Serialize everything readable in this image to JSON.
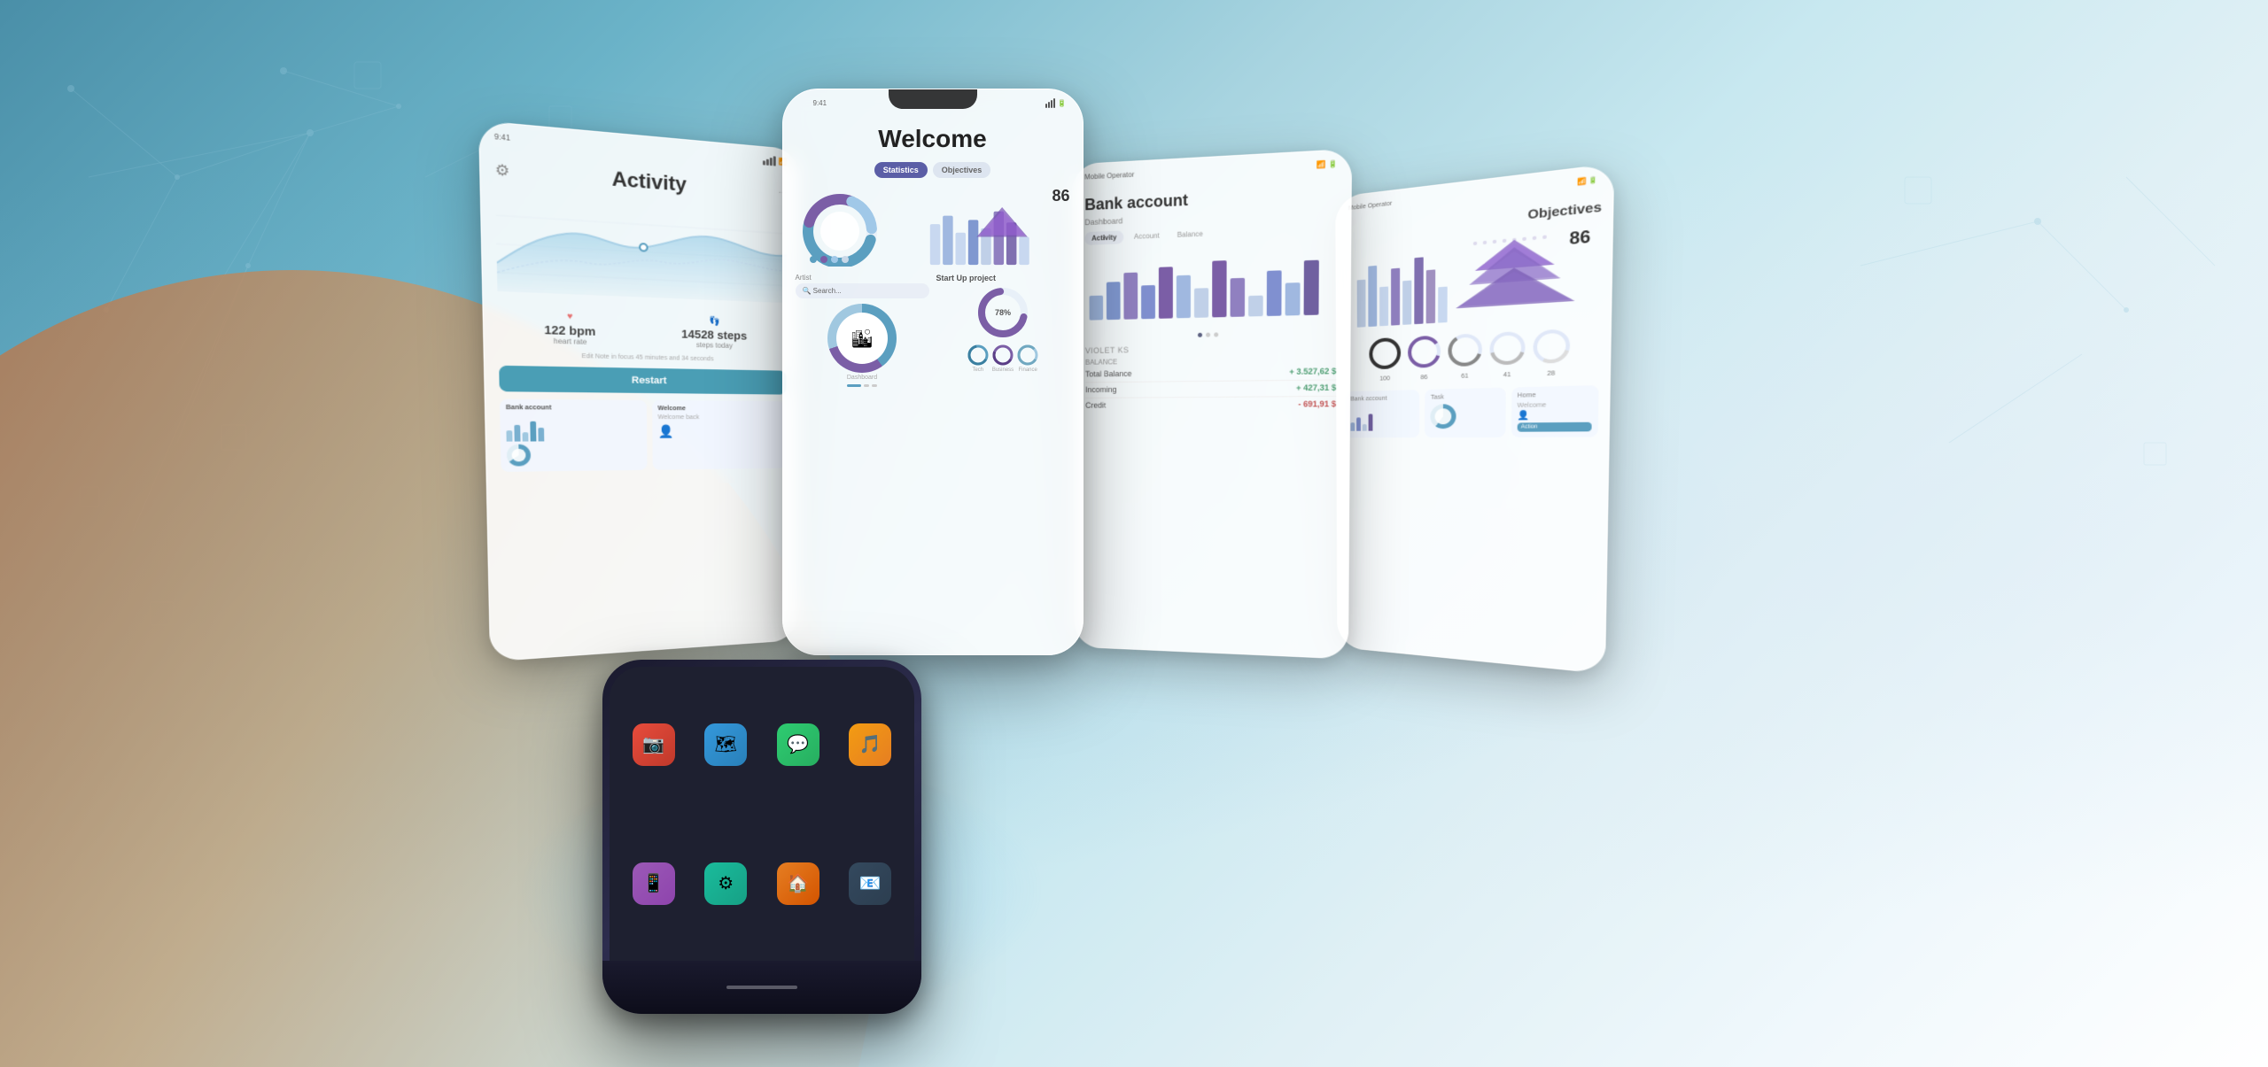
{
  "background": {
    "gradient_start": "#4a8fa8",
    "gradient_end": "#ffffff"
  },
  "phones": {
    "phone1": {
      "title": "Activity",
      "gear_icon": "⚙",
      "stats": [
        {
          "value": "122 bpm",
          "label": "heart rate"
        },
        {
          "value": "14528 steps",
          "label": "today"
        }
      ],
      "restart_button": "Restart",
      "bottom_cards": [
        {
          "title": "Bank account"
        },
        {
          "title": "Welcome"
        }
      ]
    },
    "phone2": {
      "title": "Welcome",
      "tabs": [
        {
          "label": "Statistics",
          "active": false
        },
        {
          "label": "Objectives",
          "active": true
        }
      ],
      "number": "86",
      "percent": "78%",
      "artist_label": "Artist",
      "startup_label": "Start Up project"
    },
    "phone3": {
      "title": "Bank account",
      "subtitle": "Dashboard",
      "tabs": [
        "Activity",
        "Account",
        "Balance"
      ],
      "active_tab": "Activity",
      "dots": 3,
      "balance_label": "BALANCE",
      "balance_rows": [
        {
          "name": "Total Balance",
          "value": "+ 3.527,62 $",
          "color": "green"
        },
        {
          "name": "Incoming",
          "value": "+ 427,31 $",
          "color": "green"
        },
        {
          "name": "Credit",
          "value": "- 691,91 $",
          "color": "red"
        }
      ]
    },
    "phone4": {
      "title": "Objectives",
      "number": "86",
      "circles": [
        {
          "value": "100",
          "color": "#333"
        },
        {
          "value": "86",
          "color": "#5b5ea6"
        },
        {
          "value": "61",
          "color": "#888"
        },
        {
          "value": "41",
          "color": "#bbb"
        },
        {
          "value": "28",
          "color": "#ddd"
        }
      ],
      "bottom_sections": [
        {
          "title": "Bank account"
        },
        {
          "title": "Task"
        },
        {
          "title": "Home"
        }
      ],
      "welcome_label": "Welcome"
    }
  },
  "main_phone": {
    "app_icons": [
      {
        "color": "#e74c3c",
        "emoji": "📷"
      },
      {
        "color": "#3498db",
        "emoji": "🗺"
      },
      {
        "color": "#2ecc71",
        "emoji": "💬"
      },
      {
        "color": "#f39c12",
        "emoji": "🎵"
      },
      {
        "color": "#9b59b6",
        "emoji": "📱"
      },
      {
        "color": "#1abc9c",
        "emoji": "⚙"
      },
      {
        "color": "#e67e22",
        "emoji": "🏠"
      },
      {
        "color": "#34495e",
        "emoji": "📧"
      }
    ]
  }
}
